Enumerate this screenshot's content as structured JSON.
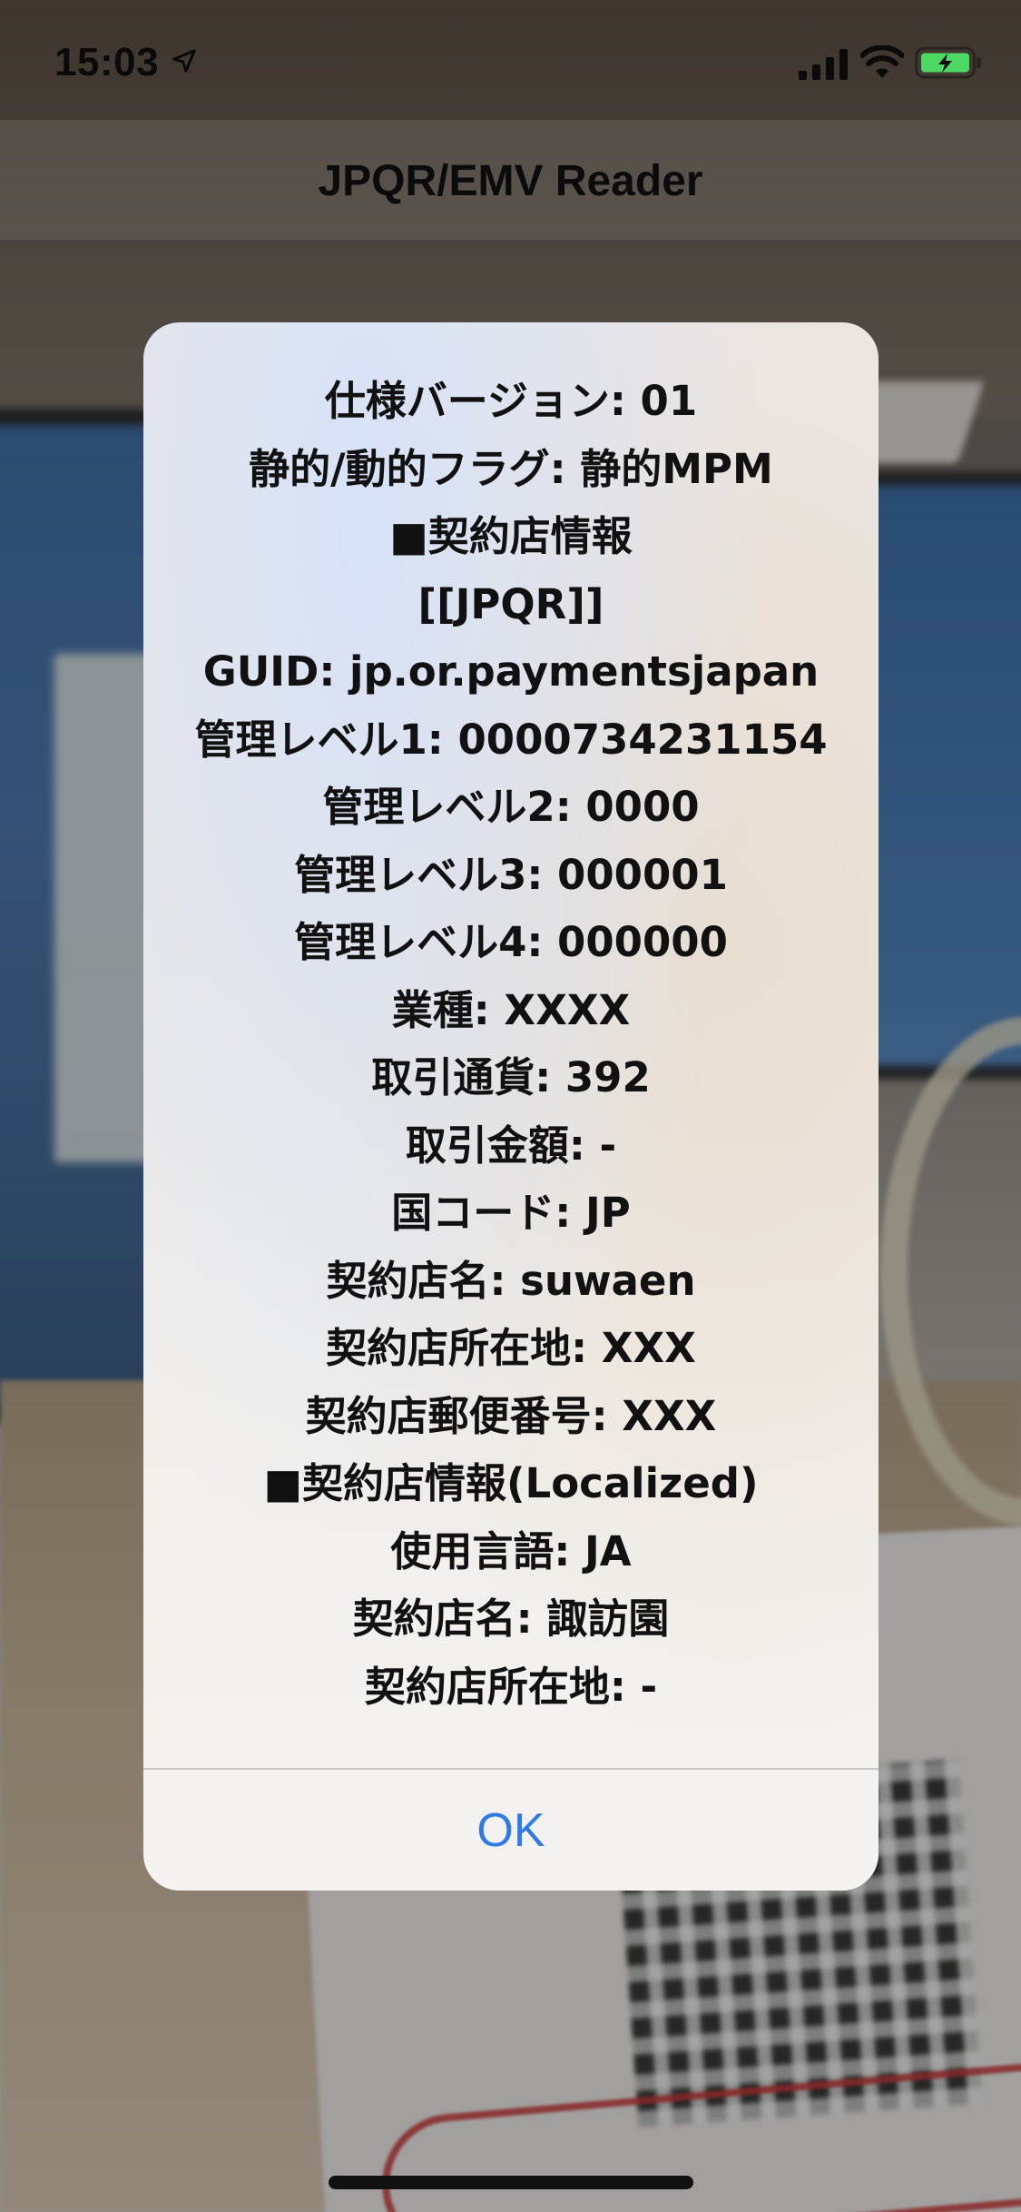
{
  "status_bar": {
    "time": "15:03",
    "icons": [
      "location-arrow-icon",
      "cellular-signal-icon",
      "wifi-icon",
      "battery-charging-icon"
    ],
    "battery_color": "#4cd964"
  },
  "nav": {
    "title": "JPQR/EMV Reader"
  },
  "alert": {
    "lines": [
      "仕様バージョン: 01",
      "静的/動的フラグ: 静的MPM",
      "■契約店情報",
      "[[JPQR]]",
      "GUID: jp.or.paymentsjapan",
      "管理レベル1: 0000734231154",
      "管理レベル2: 0000",
      "管理レベル3: 000001",
      "管理レベル4: 000000",
      "業種: XXXX",
      "取引通貨: 392",
      "取引金額: -",
      "国コード: JP",
      "契約店名: suwaen",
      "契約店所在地: XXX",
      "契約店郵便番号: XXX",
      "■契約店情報(Localized)",
      "使用言語: JA",
      "契約店名: 諏訪園",
      "契約店所在地: -"
    ],
    "ok_label": "OK",
    "accent_color": "#2f7ae5"
  }
}
